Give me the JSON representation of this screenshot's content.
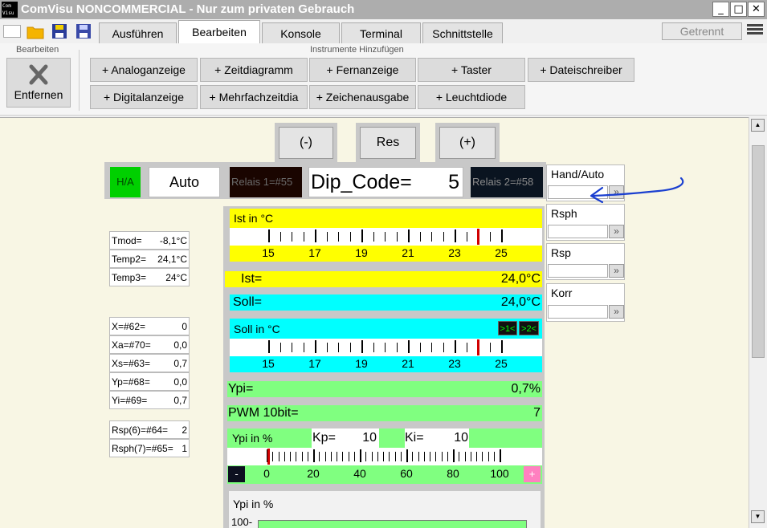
{
  "window": {
    "title": "ComVisu NONCOMMERCIAL - Nur zum privaten Gebrauch",
    "icon_text": "Com Visu",
    "min_label": "_",
    "max_label": "□",
    "close_label": "✕"
  },
  "toolbar": {
    "tabs": [
      "Ausführen",
      "Bearbeiten",
      "Konsole",
      "Terminal",
      "Schnittstelle"
    ],
    "active_tab": "Bearbeiten",
    "status": "Getrennt"
  },
  "ribbon": {
    "group1_label": "Bearbeiten",
    "remove_label": "Entfernen",
    "group2_label": "Instrumente Hinzufügen",
    "row1": [
      "+ Analoganzeige",
      "+ Zeitdiagramm",
      "+ Fernanzeige",
      "+ Taster",
      "+ Dateischreiber"
    ],
    "row2": [
      "+ Digitalanzeige",
      "+ Mehrfachzeitdia",
      "+ Zeichenausgabe",
      "+ Leuchtdiode"
    ]
  },
  "controls": {
    "minus": "(-)",
    "res": "Res",
    "plus": "(+)",
    "ha": "H/A",
    "auto": "Auto",
    "relais1": "Relais 1=#55",
    "dip_label": "Dip_Code=",
    "dip_value": "5",
    "relais2": "Relais 2=#58"
  },
  "temps": [
    {
      "label": "Tmod=",
      "value": "-8,1°C"
    },
    {
      "label": "Temp2=",
      "value": "24,1°C"
    },
    {
      "label": "Temp3=",
      "value": "24°C"
    }
  ],
  "vars": [
    {
      "label": "X=#62=",
      "value": "0"
    },
    {
      "label": "Xa=#70=",
      "value": "0,0"
    },
    {
      "label": "Xs=#63=",
      "value": "0,7"
    },
    {
      "label": "Yp=#68=",
      "value": "0,0"
    },
    {
      "label": "Yi=#69=",
      "value": "0,7"
    }
  ],
  "rsp": [
    {
      "label": "Rsp(6)=#64=",
      "value": "2"
    },
    {
      "label": "Rsph(7)=#65=",
      "value": "1"
    }
  ],
  "ist_gauge": {
    "title": "Ist in °C",
    "ticks": [
      "15",
      "17",
      "19",
      "21",
      "23",
      "25"
    ],
    "min": 14,
    "max": 26,
    "value": 24.0
  },
  "ist": {
    "label": "Ist=",
    "value": "24,0°C"
  },
  "soll": {
    "label": "Soll=",
    "value": "24,0°C"
  },
  "soll_gauge": {
    "title": "Soll in °C",
    "ticks": [
      "15",
      "17",
      "19",
      "21",
      "23",
      "25"
    ],
    "min": 14,
    "max": 26,
    "value": 24.0,
    "btn1": ">1<",
    "btn2": ">2<"
  },
  "ypi": {
    "label": "Ypi=",
    "value": "0,7%"
  },
  "pwm": {
    "label": "PWM 10bit=",
    "value": "7"
  },
  "ypi_gauge": {
    "title": "Ypi in %",
    "kp_label": "Kp=",
    "kp_value": "10",
    "ki_label": "Ki=",
    "ki_value": "10",
    "ticks": [
      "0",
      "20",
      "40",
      "60",
      "80",
      "100"
    ],
    "min": 0,
    "max": 100,
    "value": 0.7,
    "minus": "-",
    "plus": "+"
  },
  "ypi_chart": {
    "title": "Ypi in %",
    "y_tick": "100-"
  },
  "side": [
    {
      "title": "Hand/Auto",
      "go": "»"
    },
    {
      "title": "Rsph",
      "go": "»"
    },
    {
      "title": "Rsp",
      "go": "»"
    },
    {
      "title": "Korr",
      "go": "»"
    }
  ],
  "colors": {
    "yellow": "#ffff00",
    "cyan": "#00ffff",
    "green": "#80ff80",
    "marker": "#d00000",
    "annotation": "#1a3fd0"
  }
}
